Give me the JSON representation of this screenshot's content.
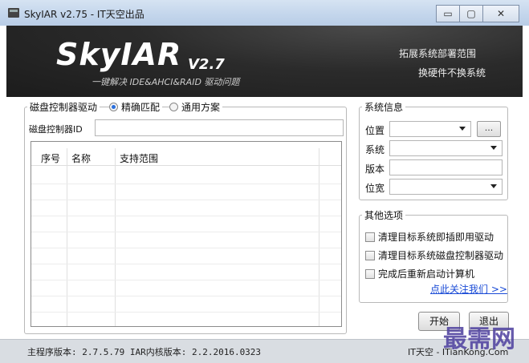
{
  "window": {
    "title": "SkyIAR v2.75 - IT天空出品",
    "buttons": [
      "▭",
      "▢",
      "✕"
    ]
  },
  "banner": {
    "logo": "SkyIAR",
    "version": "V2.7",
    "subtitle": "一键解决 IDE&AHCI&RAID 驱动问题",
    "right_line1": "拓展系统部署范围",
    "right_line2": "换硬件不换系统"
  },
  "left_panel": {
    "legend": "磁盘控制器驱动",
    "mode_options": [
      {
        "label": "精确匹配",
        "selected": true
      },
      {
        "label": "通用方案",
        "selected": false
      }
    ],
    "id_label": "磁盘控制器ID",
    "id_value": "",
    "table": {
      "columns": [
        "序号",
        "名称",
        "支持范围"
      ],
      "rows": []
    }
  },
  "system_info": {
    "legend": "系统信息",
    "location_label": "位置",
    "location_value": "",
    "browse_label": "...",
    "system_label": "系统",
    "system_value": "",
    "version_label": "版本",
    "version_value": "",
    "bitness_label": "位宽",
    "bitness_value": ""
  },
  "other_options": {
    "legend": "其他选项",
    "options": [
      {
        "label": "清理目标系统即插即用驱动",
        "checked": false
      },
      {
        "label": "清理目标系统磁盘控制器驱动",
        "checked": false
      },
      {
        "label": "完成后重新启动计算机",
        "checked": false
      }
    ],
    "follow_link": "点此关注我们 >>"
  },
  "actions": {
    "start": "开始",
    "exit": "退出"
  },
  "status": {
    "left": "主程序版本: 2.7.5.79   IAR内核版本: 2.2.2016.0323",
    "right": "IT天空 - ITianKong.Com"
  },
  "watermark": "最需网",
  "colors": {
    "banner_bg": "#2b2b2b",
    "titlebar": "#c4d6ec",
    "link": "#1a4bd6",
    "radio_selected": "#2a6fdc"
  }
}
